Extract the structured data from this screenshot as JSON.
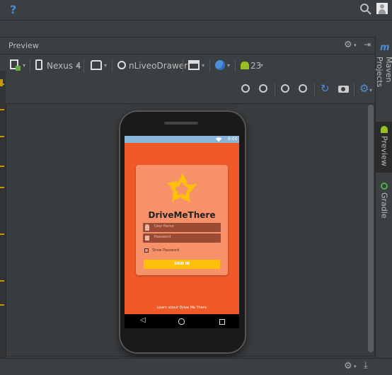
{
  "topbar": {
    "help_icon": "?",
    "search_icon": "search-icon",
    "user_icon": "user-icon"
  },
  "preview": {
    "title": "Preview",
    "toolbar": {
      "device": "Nexus 4",
      "activity": "nLiveoDrawer",
      "api_level": "23"
    }
  },
  "right_tabs": [
    {
      "label": "Maven Projects"
    },
    {
      "label": "Preview"
    },
    {
      "label": "Gradle"
    }
  ],
  "phone": {
    "status_time": "6:00",
    "app_name": "DriveMeThere",
    "user_placeholder": "User Name",
    "password_placeholder": "Password",
    "show_password_label": "Show Password",
    "signin_label": "SIGN IN",
    "footer_link": "Learn about Drive Me There"
  },
  "colors": {
    "screen_bg": "#f05a28",
    "card_bg": "#f7916a",
    "button": "#ffc107",
    "logo": "#ffc107"
  }
}
